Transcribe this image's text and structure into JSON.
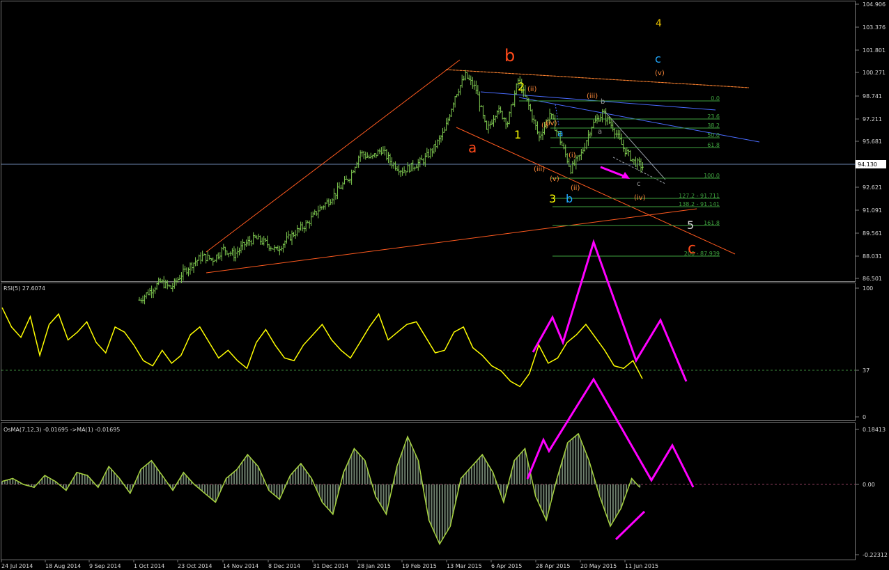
{
  "colors": {
    "background": "#000000",
    "grid": "#3a3a3a",
    "axis_text": "#d8d8d8",
    "price_bars": "#7ec850",
    "rsi_line": "#ffff00",
    "osma_line": "#a6d33e",
    "osma_hist": "#6e7f6e",
    "magenta": "#ff00ff",
    "wedge": "#ff5a1f",
    "blue_line": "#4a6cff",
    "fib": "#3fa33f",
    "current_price": "#6b86b0"
  },
  "chart_data": [
    {
      "type": "line",
      "title": "",
      "price_axis": [
        "104.906",
        "103.376",
        "101.801",
        "100.271",
        "98.741",
        "97.211",
        "95.681",
        "94.130",
        "92.621",
        "91.091",
        "89.561",
        "88.031",
        "86.501"
      ],
      "current_price": "94.130",
      "dates": [
        "24 Jul 2014",
        "18 Aug 2014",
        "9 Sep 2014",
        "1 Oct 2014",
        "23 Oct 2014",
        "14 Nov 2014",
        "8 Dec 2014",
        "31 Dec 2014",
        "28 Jan 2015",
        "19 Feb 2015",
        "13 Mar 2015",
        "6 Apr 2015",
        "28 Apr 2015",
        "20 May 2015",
        "11 Jun 2015"
      ],
      "closes": [
        85.2,
        85.8,
        86.4,
        86.0,
        86.9,
        87.6,
        88.1,
        87.9,
        88.6,
        88.2,
        88.9,
        89.3,
        89.0,
        88.5,
        89.2,
        89.8,
        90.3,
        91.2,
        91.8,
        92.6,
        93.4,
        95.0,
        94.6,
        95.2,
        94.3,
        93.8,
        94.1,
        94.5,
        95.3,
        96.4,
        98.8,
        100.1,
        99.2,
        96.4,
        97.9,
        97.0,
        99.8,
        98.1,
        96.0,
        97.6,
        95.8,
        93.9,
        94.9,
        96.8,
        97.6,
        96.7,
        95.3,
        94.4,
        94.0
      ],
      "fib_levels": [
        "0.0",
        "23.6",
        "38.2",
        "50.0",
        "61.8",
        "100.0",
        "127.2 - 91.711",
        "138.2 - 91.141",
        "161.8",
        "200 - 87.939"
      ],
      "wave_labels": [
        "b",
        "a",
        "c",
        "4",
        "c",
        "(v)",
        "2",
        "(ii)",
        "(iii)",
        "b",
        "1",
        "(i)",
        "(iv)",
        "a",
        "a",
        "(i)",
        "(iii)",
        "(v)",
        "(ii)",
        "3",
        "b",
        "(iv)",
        "c",
        "5"
      ]
    },
    {
      "type": "line",
      "title": "RSI(5) 27.6074",
      "axis": [
        "100",
        "37",
        "0"
      ],
      "values": [
        85,
        70,
        62,
        78,
        48,
        72,
        80,
        60,
        66,
        74,
        58,
        50,
        70,
        66,
        56,
        44,
        40,
        52,
        42,
        48,
        64,
        70,
        58,
        46,
        52,
        44,
        38,
        58,
        68,
        56,
        46,
        44,
        56,
        64,
        72,
        60,
        52,
        46,
        58,
        70,
        80,
        60,
        66,
        72,
        74,
        62,
        50,
        52,
        66,
        70,
        54,
        48,
        40,
        36,
        28,
        24,
        34,
        56,
        42,
        46,
        58,
        64,
        72,
        62,
        52,
        40,
        38,
        44,
        30
      ]
    },
    {
      "type": "line",
      "title": "OsMA(7,12,3) -0.01695  ->MA(1) -0.01695",
      "axis": [
        "0.18413",
        "0.00",
        "-0.22312"
      ],
      "values": [
        0.01,
        0.02,
        0.0,
        -0.01,
        0.03,
        0.01,
        -0.02,
        0.04,
        0.03,
        -0.01,
        0.06,
        0.02,
        -0.03,
        0.05,
        0.08,
        0.03,
        -0.02,
        0.04,
        0.0,
        -0.03,
        -0.06,
        0.02,
        0.05,
        0.1,
        0.06,
        -0.02,
        -0.05,
        0.03,
        0.07,
        0.02,
        -0.06,
        -0.1,
        0.04,
        0.12,
        0.08,
        -0.04,
        -0.1,
        0.06,
        0.16,
        0.08,
        -0.12,
        -0.2,
        -0.14,
        0.02,
        0.06,
        0.1,
        0.04,
        -0.06,
        0.08,
        0.12,
        -0.04,
        -0.12,
        0.02,
        0.14,
        0.17,
        0.08,
        -0.04,
        -0.14,
        -0.08,
        0.02,
        -0.02
      ]
    }
  ]
}
